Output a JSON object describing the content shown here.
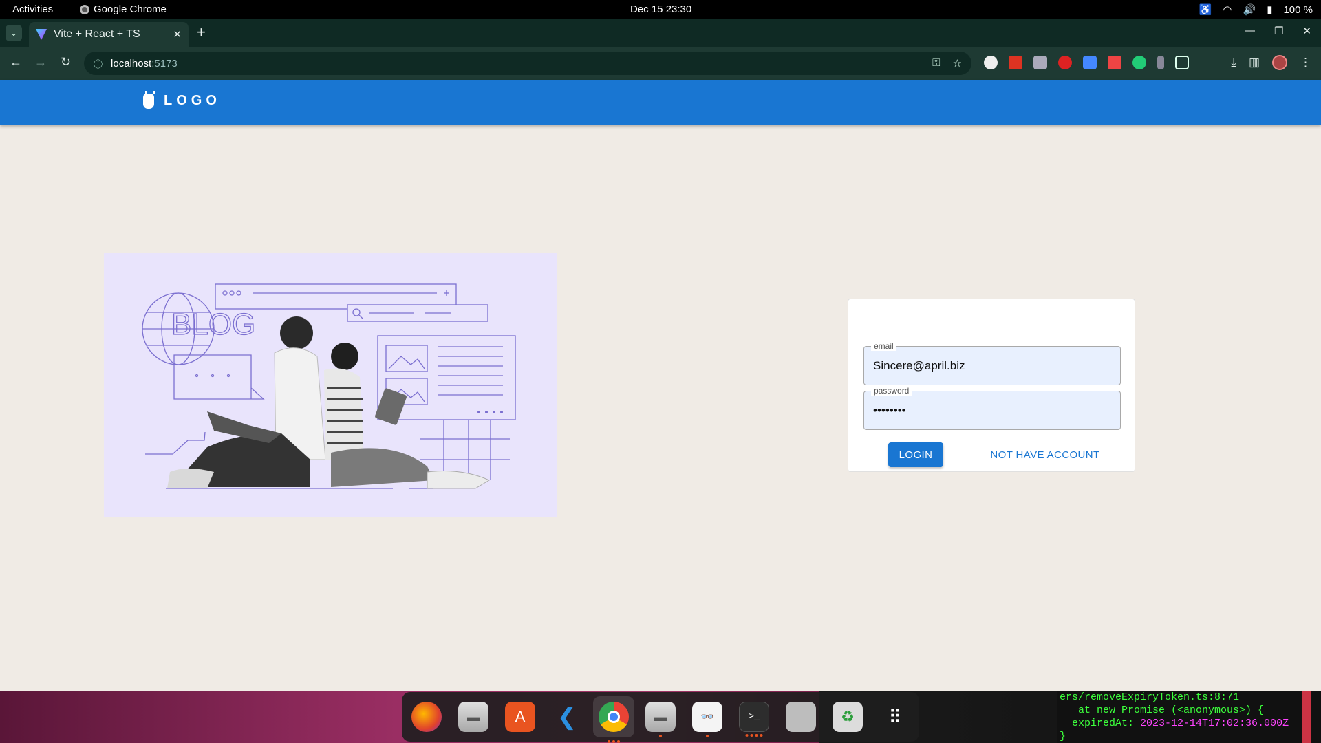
{
  "system_bar": {
    "activities": "Activities",
    "app_name": "Google Chrome",
    "clock": "Dec 15  23:30",
    "battery": "100 %"
  },
  "browser": {
    "tab_title": "Vite + React + TS",
    "url_host": "localhost",
    "url_port": ":5173",
    "icons": [
      "tab-search-icon",
      "close-icon",
      "new-tab-icon",
      "minimize-icon",
      "maximize-icon",
      "window-close-icon",
      "back-icon",
      "forward-icon",
      "reload-icon",
      "site-info-icon",
      "password-key-icon",
      "bookmark-star-icon",
      "extensions-icon",
      "download-icon",
      "side-panel-icon",
      "menu-icon"
    ]
  },
  "app": {
    "logo_text": "LOGO",
    "illustration": {
      "blog_label": "BLOG",
      "colors": {
        "background": "#e9e4fc",
        "line": "#7b6fd0"
      }
    },
    "login_form": {
      "email_label": "email",
      "email_value": "Sincere@april.biz",
      "password_label": "password",
      "password_value": "••••••••",
      "login_button": "LOGIN",
      "register_button": "NOT HAVE ACCOUNT"
    },
    "colors": {
      "primary": "#1976d2",
      "page_bg": "#f0ebe5"
    }
  },
  "dock": {
    "items": [
      "firefox-icon",
      "files-icon",
      "app-center-icon",
      "vscode-icon",
      "chrome-icon",
      "files-2-icon",
      "document-viewer-icon",
      "terminal-icon",
      "disks-icon",
      "trash-icon",
      "app-grid-icon"
    ]
  },
  "terminal": {
    "line1": "ers/removeExpiryToken.ts:8:71",
    "line2": "   at new Promise (<anonymous>) {",
    "line3_key": "  expiredAt: ",
    "line3_value": "2023-12-14T17:02:36.000Z",
    "line4": "}"
  }
}
